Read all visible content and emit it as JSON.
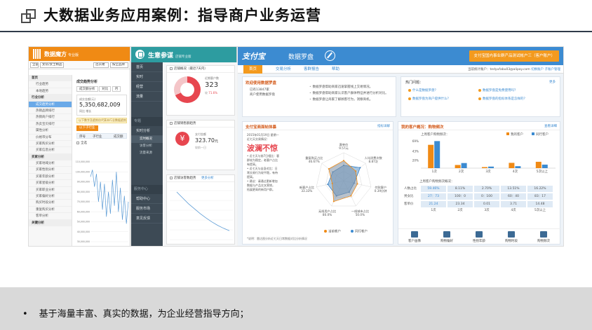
{
  "slide": {
    "title": "大数据业务应用案例：指导商户业务运营",
    "bullet": "基于海量丰富、真实的数据，为企业经营指导方向；"
  },
  "panel1": {
    "brand": "数据魔方",
    "brand_sub": "专业版",
    "filters": [
      "全部",
      "女装/女士精品",
      "连衣裙",
      "按全品牌"
    ],
    "sidebar": [
      {
        "label": "首页",
        "hd": true
      },
      {
        "label": "行业趋势"
      },
      {
        "label": "本地趋势"
      },
      {
        "label": "行业分析",
        "hd": true
      },
      {
        "label": "成交趋势分析",
        "act": true
      },
      {
        "label": "热销品牌排行"
      },
      {
        "label": "热销商户排行"
      },
      {
        "label": "热卖宝贝排行"
      },
      {
        "label": "属性分析"
      },
      {
        "label": "价格带分布"
      },
      {
        "label": "买家购买分析"
      },
      {
        "label": "买家信息分析"
      },
      {
        "label": "买家分析",
        "hd": true
      },
      {
        "label": "买家地域分析"
      },
      {
        "label": "买家性别分析"
      },
      {
        "label": "买家年龄分析"
      },
      {
        "label": "买家星级分析"
      },
      {
        "label": "买家职业分析"
      },
      {
        "label": "买家偏好分析"
      },
      {
        "label": "购买时段分析"
      },
      {
        "label": "重复购买分析"
      },
      {
        "label": "客单分析"
      },
      {
        "label": "关键分析",
        "hd": true
      }
    ],
    "section_title": "成交趋势分析",
    "tabs": [
      "成交额分析",
      "对比",
      "月"
    ],
    "stat_label": "成交金额(元)",
    "stat_value": "5,350,682,009",
    "stat_sub": "同比 增长",
    "warning": "以下数字及趋势仅代表本行业数据趋势(无)",
    "subtab": "以下子行业",
    "table_cols": [
      "序号",
      "子行业",
      "成交额"
    ],
    "checkbox": "全选",
    "chart_y_ticks": [
      "110,000,000",
      "100,000,000",
      "90,000,000",
      "80,000,000",
      "70,000,000",
      "60,000,000",
      "50,000,000",
      "40,000,000",
      "30,000,000"
    ]
  },
  "panel2": {
    "brand": "生意参谋",
    "brand_sub": "店铺专业版",
    "sidebar_top": [
      "首页",
      "实时",
      "经营",
      "流量"
    ],
    "group1": "专题",
    "items1": [
      "实时分析"
    ],
    "subs1": [
      "实时概况",
      "访客分析",
      "流量来源"
    ],
    "group2": "服务中心",
    "items2": [
      "帮助中心",
      "服务市场",
      "意见反馈"
    ],
    "card1_title": "店铺概况（最近7天内）",
    "card1_label": "近期客户数",
    "card1_value": "323",
    "card1_sub_prefix": "较",
    "card1_sub_change": "71.6%",
    "card2_title": "店铺销售额趋势",
    "card2_label": "支付金额",
    "card2_value": "323.70",
    "card2_unit": "元",
    "card2_sub": "较前一日",
    "card3_title": "店铺访客数趋势",
    "card3_more": "更多分析"
  },
  "panel3": {
    "logo": "支付宝",
    "product": "数据罗盘",
    "account": "支付宝国内事业群产品测试帐户三（客户账户）",
    "nav": [
      "首页",
      "交易分析",
      "客群报告",
      "帮助"
    ],
    "nav_right_prefix": "当前统计账户：",
    "nav_right_acct": "tedyufabu03@alipay.com",
    "nav_right_links": [
      "切换账户",
      "子账户管理"
    ],
    "welcome_title": "欢迎使用数据罗盘",
    "welcome_lines": [
      "已有13847家",
      "商户使用数据罗盘"
    ],
    "welcome_points": [
      "数据罗盘帮助商家迅速掌握线上交易情况。",
      "数据罗盘帮助商家认识客户群体特征并进行分析对比。",
      "数据罗盘让商家了解顾客行为，洞察商机。"
    ],
    "faq_title": "热门问题：",
    "faq_more": "更多",
    "faq": [
      "什么是数据罗盘？",
      "数据罗盘是免费使用吗？",
      "数据罗盘为商户提供什么？",
      "数据罗盘的指标体系是怎样的？"
    ],
    "store_title": "支付宝商面帖体暴",
    "store_more": "指标详解",
    "store_date": [
      "2015年01月19日 星期一",
      "近七天交易情况："
    ],
    "store_big": "波澜不惊",
    "store_notes": [
      "• 近七天与前7日相比：客",
      "  群较为稳定，老客户占比",
      "  有提高。",
      "• 近七天与自身对比：日",
      "  常交易行为较平稳，有待",
      "  提高。",
      "• 建议：请通过更新增加",
      "  数据与产品交叉营销，",
      "  拓展更高的新用户群。"
    ],
    "store_foot": "*说明：雷达图分析近七天日常数据对比分析情况",
    "radar_legend": [
      "当前客户",
      "同行客户"
    ],
    "radar_axes": [
      {
        "label": "客单价",
        "value": "9.57元"
      },
      {
        "label": "人均消费次数",
        "value": "8.87次"
      },
      {
        "label": "付款客户",
        "value": "0.39分钟"
      },
      {
        "label": "一线城市占比",
        "value": "50.0%"
      },
      {
        "label": "无线用户占比",
        "value": "80.0%"
      },
      {
        "label": "新客户占比",
        "value": "33.33%"
      },
      {
        "label": "重复购买占比",
        "value": "46.67%"
      }
    ],
    "profile_title": "我的客户概况：购物频次",
    "profile_more": "查看详细",
    "bars_caption": "上周客户购物频次：",
    "bars_legend": [
      "我的客户",
      "同行客户"
    ],
    "bars_y_ticks": [
      "69%",
      "43%",
      "20%"
    ],
    "bars_categories": [
      "1次",
      "2次",
      "3次",
      "4次",
      "5次以上"
    ],
    "tbl_caption": "上周客户购物频次概况：",
    "tbl_rows": [
      {
        "label": "人数占比",
        "cells": [
          "59.46%",
          "8.11%",
          "2.70%",
          "13.51%",
          "16.22%"
        ]
      },
      {
        "label": "男女比",
        "cells": [
          "27：73",
          "100：0",
          "0：100",
          "60：40",
          "83：17"
        ]
      },
      {
        "label": "客单价",
        "cells": [
          "21.24",
          "23.34",
          "0.01",
          "3.71",
          "14.48"
        ]
      }
    ],
    "tbl_cols": [
      "1次",
      "2次",
      "3次",
      "4次",
      "5次以上"
    ],
    "bottom_icons": [
      "客户画像",
      "购物偏好",
      "性别年龄",
      "购物时段",
      "购物频次"
    ]
  },
  "chart_data": [
    {
      "type": "bar",
      "title": "上周客户购物频次：",
      "categories": [
        "1次",
        "2次",
        "3次",
        "4次",
        "5次以上"
      ],
      "series": [
        {
          "name": "我的客户",
          "values": [
            59.46,
            8.11,
            2.7,
            13.51,
            16.22
          ]
        },
        {
          "name": "同行客户",
          "values": [
            69,
            13,
            4,
            5,
            9
          ]
        }
      ],
      "ylim": [
        0,
        75
      ],
      "colors": [
        "#f08a14",
        "#3c8bd1"
      ]
    },
    {
      "type": "line",
      "ylim": [
        30000000,
        110000000
      ],
      "y_ticks": [
        "110,000,000",
        "100,000,000",
        "90,000,000",
        "80,000,000",
        "70,000,000",
        "60,000,000",
        "50,000,000",
        "40,000,000",
        "30,000,000"
      ],
      "series": [
        {
          "values": [
            95000000,
            102000000,
            85000000,
            98000000,
            70000000,
            90000000,
            62000000,
            88000000,
            55000000,
            80000000,
            58000000,
            92000000,
            66000000,
            100000000,
            60000000,
            84000000,
            52000000,
            76000000,
            48000000,
            70000000
          ]
        }
      ]
    },
    {
      "type": "line",
      "title": "店铺访客数趋势",
      "series": [
        {
          "values": [
            100,
            88,
            76,
            66,
            56,
            47,
            39,
            32,
            26,
            21
          ]
        }
      ]
    }
  ]
}
